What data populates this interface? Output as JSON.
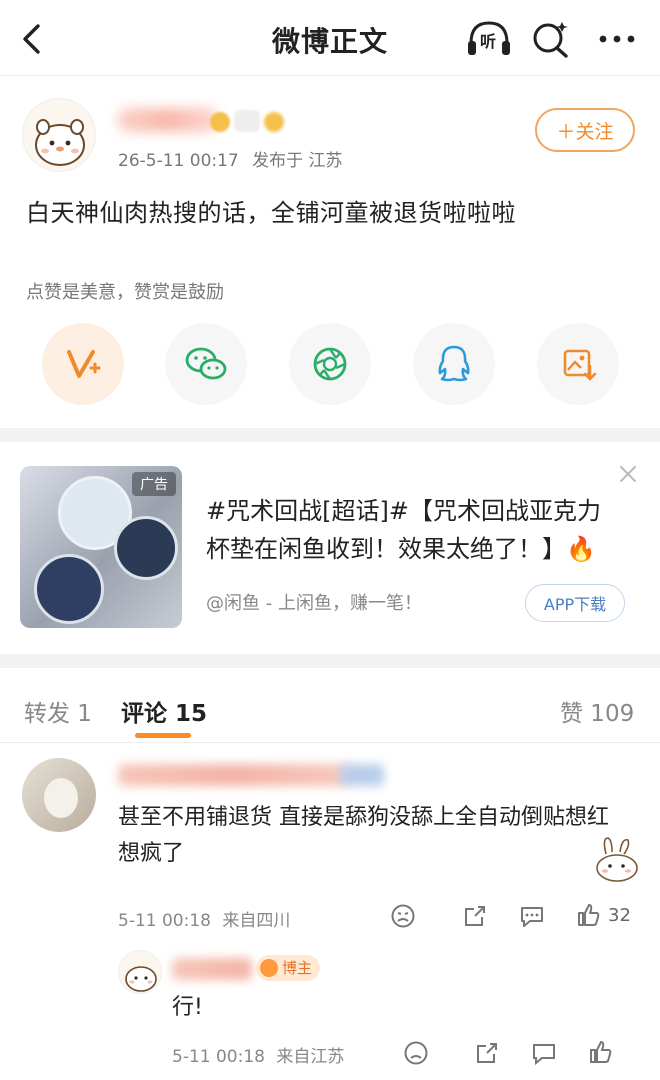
{
  "header": {
    "title": "微博正文",
    "listen_label": "听"
  },
  "post": {
    "time": "26-5-11 00:17",
    "published_in": "发布于 江苏",
    "follow_label": "＋关注",
    "text": "白天神仙肉热搜的话，全铺河童被退货啦啦啦",
    "reward_hint": "点赞是美意，赞赏是鼓励",
    "share_targets": [
      "vplus-icon",
      "wechat-icon",
      "moments-icon",
      "qq-icon",
      "save-image-icon"
    ]
  },
  "ad": {
    "tag": "广告",
    "title": "#咒术回战[超话]#【咒术回战亚克力杯垫在闲鱼收到！效果太绝了！】🔥",
    "sub": "@闲鱼 - 上闲鱼，赚一笔！",
    "button": "APP下载"
  },
  "tabs": {
    "repost": "转发 1",
    "comment": "评论 15",
    "like": "赞 109"
  },
  "comments": [
    {
      "text": "甚至不用铺退货 直接是舔狗没舔上全自动倒贴想红想疯了",
      "time": "5-11 00:18",
      "location": "来自四川",
      "likes": "32"
    },
    {
      "badge": "博主",
      "text": "行!",
      "time": "5-11 00:18",
      "location": "来自江苏"
    }
  ],
  "colors": {
    "accent": "#ff8a1f",
    "follow_border": "#f1a562",
    "wechat": "#2aae67",
    "qq": "#2c9bd8"
  }
}
